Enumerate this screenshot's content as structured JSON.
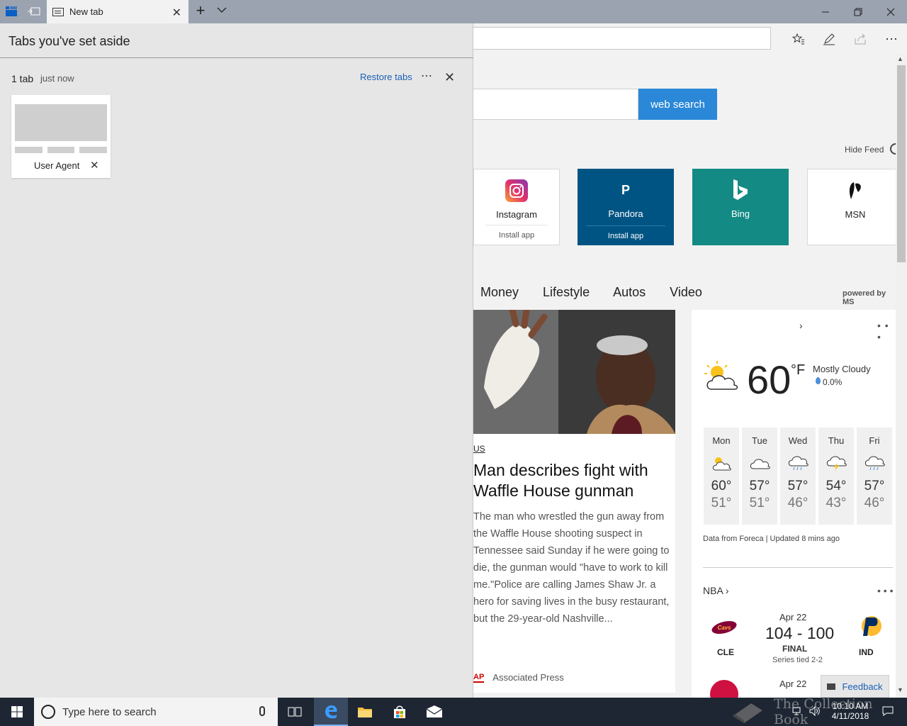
{
  "browser": {
    "tab_title": "New tab",
    "search_button": "web search",
    "hide_feed": "Hide Feed"
  },
  "tiles": [
    {
      "name": "Instagram",
      "sub": "Install app",
      "bg": "#ffffff",
      "fg": "#222222",
      "icon": "instagram-icon"
    },
    {
      "name": "Pandora",
      "sub": "Install app",
      "bg": "#005483",
      "fg": "#ffffff",
      "icon": "pandora-icon",
      "letter": "P"
    },
    {
      "name": "Bing",
      "sub": "",
      "bg": "#138a84",
      "fg": "#ffffff",
      "icon": "bing-icon"
    },
    {
      "name": "MSN",
      "sub": "",
      "bg": "#ffffff",
      "fg": "#222222",
      "icon": "msn-icon"
    }
  ],
  "categories": [
    "Money",
    "Lifestyle",
    "Autos",
    "Video"
  ],
  "powered_by": "powered by MS",
  "news": {
    "label": "US",
    "headline": "Man describes fight with Waffle House gunman",
    "summary": "The man who wrestled the gun away from the Waffle House shooting suspect in Tennessee said Sunday if he were going to die, the gunman would \"have to work to kill me.\"Police are calling James Shaw Jr. a hero for saving lives in the busy restaurant, but the 29-year-old Nashville...",
    "source_logo": "AP",
    "source": "Associated Press"
  },
  "weather": {
    "temp": "60",
    "unit": "°F",
    "condition": "Mostly Cloudy",
    "precip": "0.0%",
    "days": [
      {
        "day": "Mon",
        "hi": "60°",
        "lo": "51°",
        "icon": "partly-sunny-icon"
      },
      {
        "day": "Tue",
        "hi": "57°",
        "lo": "51°",
        "icon": "cloudy-icon"
      },
      {
        "day": "Wed",
        "hi": "57°",
        "lo": "46°",
        "icon": "rain-icon"
      },
      {
        "day": "Thu",
        "hi": "54°",
        "lo": "43°",
        "icon": "thunderstorm-icon"
      },
      {
        "day": "Fri",
        "hi": "57°",
        "lo": "46°",
        "icon": "rain-icon"
      }
    ],
    "footer": "Data from Foreca | Updated 8 mins ago"
  },
  "nba": {
    "title": "NBA",
    "game1": {
      "date": "Apr 22",
      "score": "104 - 100",
      "status": "FINAL",
      "series": "Series tied 2-2",
      "home": "CLE",
      "away": "IND"
    },
    "game2": {
      "date": "Apr 22"
    }
  },
  "feedback": "Feedback",
  "panel": {
    "title": "Tabs you've set aside",
    "count": "1 tab",
    "time": "just now",
    "restore": "Restore tabs",
    "tab_label": "User Agent"
  },
  "taskbar": {
    "search_placeholder": "Type here to search",
    "time": "10:10 AM",
    "date": "4/11/2018",
    "watermark": "The Collection Book"
  }
}
